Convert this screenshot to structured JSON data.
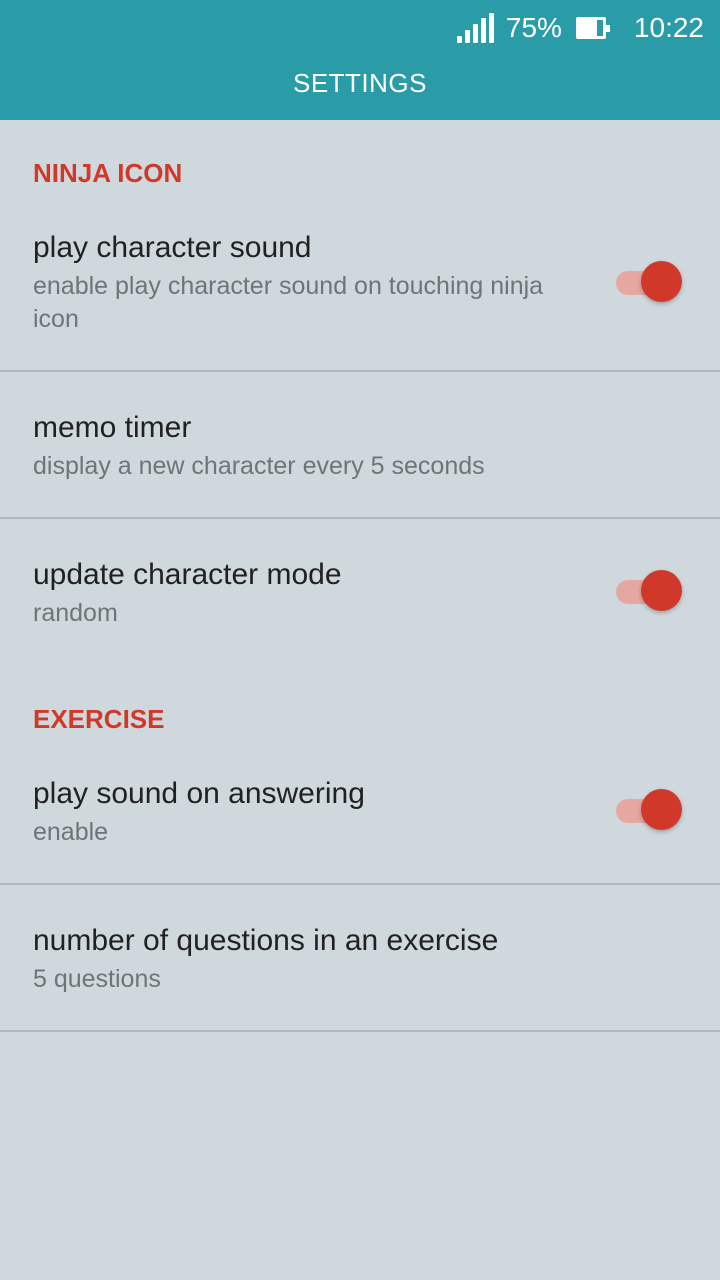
{
  "colors": {
    "header_bg": "#2a9ca8",
    "accent": "#d0392a",
    "switch_track_on": "#e6a7a3",
    "switch_thumb_on": "#d0392a",
    "background": "#cfd8dc"
  },
  "status_bar": {
    "signal_icon": "signal-icon",
    "battery_percent": "75%",
    "battery_level": 0.75,
    "battery_icon": "battery-icon",
    "time": "10:22"
  },
  "header": {
    "title": "SETTINGS"
  },
  "sections": [
    {
      "header": "NINJA ICON",
      "items": [
        {
          "title": "play character sound",
          "summary": "enable play character sound on touching ninja icon",
          "switch_on": true
        },
        {
          "title": "memo timer",
          "summary": "display a new character every 5 seconds"
        },
        {
          "title": "update character mode",
          "summary": "random",
          "switch_on": true
        }
      ]
    },
    {
      "header": "EXERCISE",
      "items": [
        {
          "title": "play sound on answering",
          "summary": "enable",
          "switch_on": true
        },
        {
          "title": "number of questions in an exercise",
          "summary": "5 questions"
        }
      ]
    }
  ]
}
